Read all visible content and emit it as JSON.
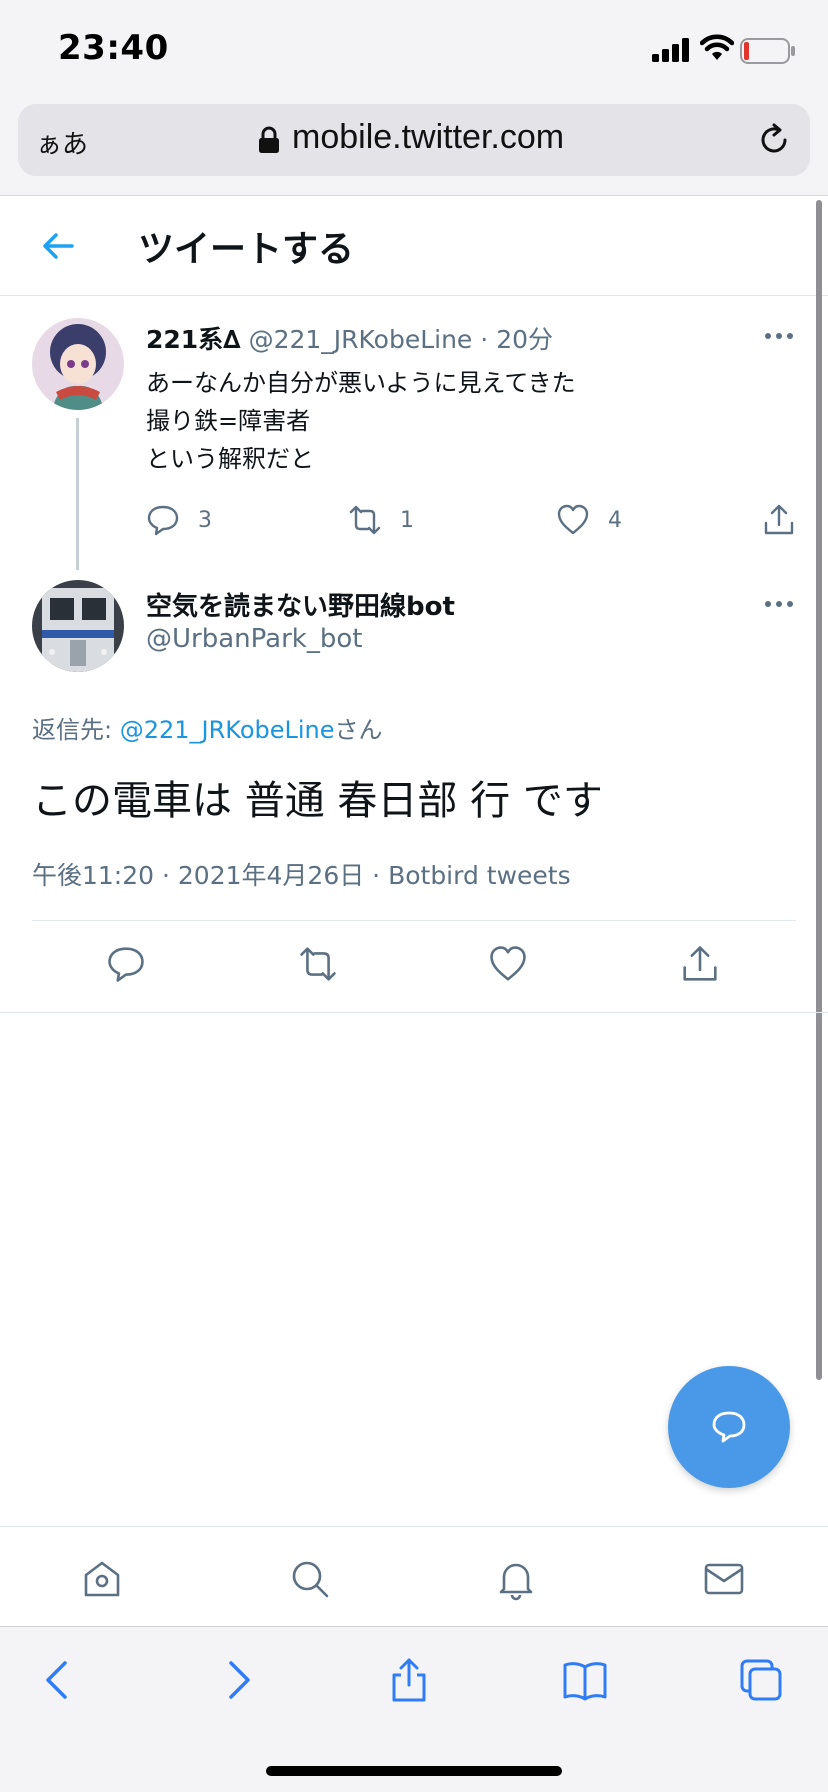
{
  "status_bar": {
    "time": "23:40",
    "icons": [
      "cellular-signal-icon",
      "wifi-icon",
      "battery-low-icon"
    ]
  },
  "browser": {
    "text_size_label": "ぁあ",
    "url": "mobile.twitter.com",
    "icons": [
      "lock-icon",
      "reload-icon"
    ]
  },
  "header": {
    "title": "ツイートする",
    "back_icon": "back-arrow-icon"
  },
  "parent_tweet": {
    "name": "221系∆",
    "handle": "@221_JRKobeLine",
    "separator": "·",
    "time": "20分",
    "lines": [
      "あーなんか自分が悪いように見えてきた",
      "撮り鉄=障害者",
      "という解釈だと"
    ],
    "reply_count": "3",
    "retweet_count": "1",
    "like_count": "4"
  },
  "main_tweet": {
    "name": "空気を読まない野田線bot",
    "handle": "@UrbanPark_bot",
    "reply_prefix": "返信先: ",
    "reply_mention": "@221_JRKobeLine",
    "reply_suffix": "さん",
    "text": "この電車は 普通 春日部 行 です",
    "meta": "午後11:20 · 2021年4月26日 · Botbird tweets"
  },
  "colors": {
    "accent": "#1da1f2",
    "fab": "#4a99e9",
    "secondary_text": "#5b7083",
    "divider": "#e1e8ed",
    "safari_blue": "#2f7cf6"
  },
  "bottom_nav": [
    "home-icon",
    "search-icon",
    "notifications-icon",
    "messages-icon"
  ],
  "safari_toolbar": [
    "back-icon",
    "forward-icon",
    "share-icon",
    "bookmarks-icon",
    "tabs-icon"
  ]
}
